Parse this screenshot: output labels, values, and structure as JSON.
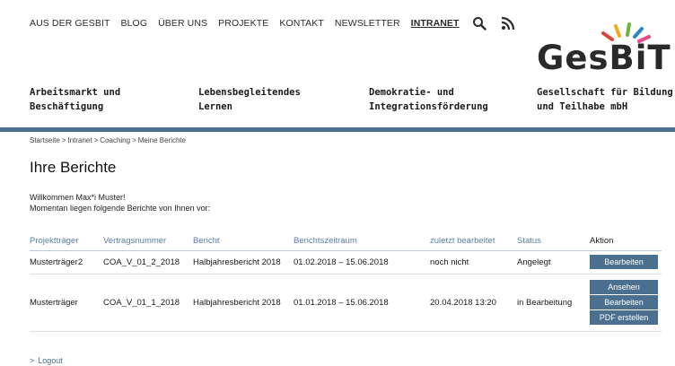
{
  "top_nav": {
    "items": [
      {
        "label": "AUS DER GESBIT"
      },
      {
        "label": "BLOG"
      },
      {
        "label": "ÜBER UNS"
      },
      {
        "label": "PROJEKTE"
      },
      {
        "label": "KONTAKT"
      },
      {
        "label": "NEWSLETTER"
      },
      {
        "label": "INTRANET"
      }
    ],
    "search_icon": "search-icon",
    "feed_icon": "rss-icon"
  },
  "logo": {
    "text": "GesBiT",
    "colors": [
      "#e2403a",
      "#f4a81c",
      "#6cb33f",
      "#2f86c6",
      "#e84a8a"
    ]
  },
  "category_nav": [
    {
      "line1": "Arbeitsmarkt und",
      "line2": "Beschäftigung"
    },
    {
      "line1": "Lebensbegleitendes",
      "line2": "Lernen"
    },
    {
      "line1": "Demokratie- und",
      "line2": "Integrationsförderung"
    }
  ],
  "tagline": {
    "line1": "Gesellschaft für Bildung",
    "line2": "und Teilhabe mbH"
  },
  "breadcrumb": [
    "Startseite",
    "Intranet",
    "Coaching",
    "Meine Berichte"
  ],
  "page": {
    "title": "Ihre Berichte",
    "welcome": "Willkommen Max*i Muster!",
    "intro": "Momentan liegen folgende Berichte von Ihnen vor:"
  },
  "table": {
    "headers": [
      "Projektträger",
      "Vertragsnummer",
      "Bericht",
      "Berichtszeitraum",
      "zuletzt bearbeitet",
      "Status",
      "Aktion"
    ],
    "rows": [
      {
        "traeger": "Musterträger2",
        "vertrag": "COA_V_01_2_2018",
        "bericht": "Halbjahresbericht 2018",
        "zeitraum": "01.02.2018 – 15.06.2018",
        "bearbeitet": "noch nicht",
        "status": "Angelegt",
        "actions": [
          "Bearbeiten"
        ]
      },
      {
        "traeger": "Musterträger",
        "vertrag": "COA_V_01_1_2018",
        "bericht": "Halbjahresbericht 2018",
        "zeitraum": "01.01.2018 – 15.06.2018",
        "bearbeitet": "20.04.2018 13:20",
        "status": "in Bearbeitung",
        "actions": [
          "Ansehen",
          "Bearbeiten",
          "PDF erstellen"
        ]
      }
    ]
  },
  "logout": {
    "label": "Logout"
  },
  "colors": {
    "accent": "#4a6f8f",
    "header_text": "#5b7fa6"
  }
}
